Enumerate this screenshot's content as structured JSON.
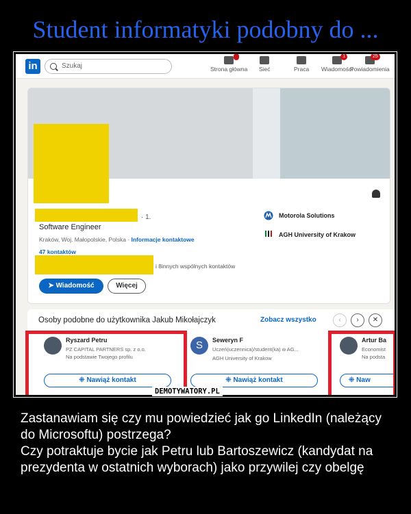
{
  "meme_title": "Student informatyki podobny do ...",
  "nav": {
    "logo": "in",
    "search_placeholder": "Szukaj",
    "items": [
      {
        "label": "Strona główna",
        "icon": "home-icon",
        "badge": ""
      },
      {
        "label": "Sieć",
        "icon": "network-icon",
        "badge": ""
      },
      {
        "label": "Praca",
        "icon": "briefcase-icon",
        "badge": ""
      },
      {
        "label": "Wiadomości",
        "icon": "messaging-icon",
        "badge": "1"
      },
      {
        "label": "Powiadomienia",
        "icon": "bell-icon",
        "badge": "25"
      }
    ]
  },
  "profile": {
    "degree": "· 1.",
    "headline": "Software Engineer",
    "location": "Kraków, Woj. Małopolskie, Polska ·",
    "contact_link": "Informacje kontaktowe",
    "connections": "47 kontaktów",
    "mutual": "i 8innych wspólnych kontaktów",
    "message_button": "Wiadomość",
    "more_button": "Więcej",
    "organizations": [
      {
        "name": "Motorola Solutions",
        "icon": "motorola-logo-icon"
      },
      {
        "name": "AGH University of Krakow",
        "icon": "agh-logo-icon"
      }
    ]
  },
  "people": {
    "title": "Osoby podobne do użytkownika Jakub Mikołajczyk",
    "see_all": "Zobacz wszystko",
    "cards": [
      {
        "name": "Ryszard Petru",
        "line1": "PZ CAPITAL PARTNERS sp. z o.o.",
        "line2": "Na podstawie Twojego profilu",
        "button": "Nawiąż kontakt"
      },
      {
        "name": "Seweryn F",
        "initial": "S",
        "line1": "Uczeń(uczennica)/student(ka) w AG...",
        "line2": "AGH University of Krakow",
        "button": "Nawiąż kontakt"
      },
      {
        "name": "Artur Ba",
        "line1": "Economist",
        "line2": "Na podsta",
        "button": "Naw"
      }
    ]
  },
  "watermark": "DEMOTYWATORY.PL",
  "caption": [
    "Zastanawiam się czy mu powiedzieć jak go LinkedIn (należący do Microsoftu) postrzega?",
    "Czy potraktuje bycie jak Petru lub Bartoszewicz (kandydat na prezydenta w ostatnich wyborach) jako przywilej czy obelgę"
  ],
  "colors": {
    "title": "#2563eb",
    "linkedin_blue": "#0a66c2",
    "highlight_red": "#e0202c",
    "redaction_yellow": "#f0d200"
  }
}
